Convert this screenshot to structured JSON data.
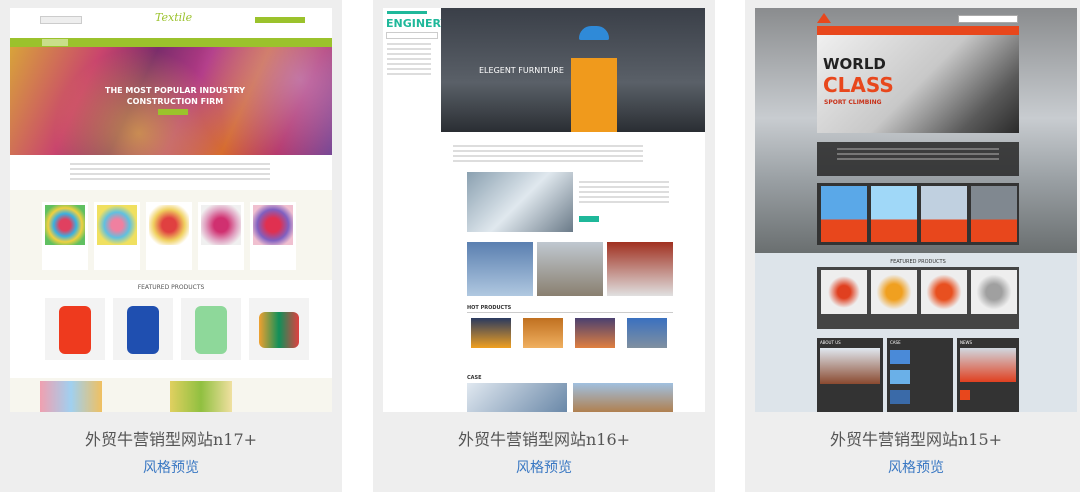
{
  "templates": [
    {
      "caption": "外贸牛营销型网站n17+",
      "preview_label": "风格预览",
      "logo_text": "Textile",
      "hero_title": "THE MOST POPULAR INDUSTRY CONSTRUCTION FIRM",
      "section_title": "FEATURED PRODUCTS",
      "colors": {
        "accent": "#9bc22c",
        "bg": "#f7f6ee"
      }
    },
    {
      "caption": "外贸牛营销型网站n16+",
      "preview_label": "风格预览",
      "logo_text": "ENGINERY",
      "hero_title": "ELEGENT FURNITURE",
      "section_title": "HOT PRODUCTS",
      "case_title": "CASE",
      "colors": {
        "accent": "#1fb89a",
        "bg": "#ffffff"
      }
    },
    {
      "caption": "外贸牛营销型网站n15+",
      "preview_label": "风格预览",
      "hero_title_1": "WORLD",
      "hero_title_2": "CLASS",
      "hero_sub": "SPORT CLIMBING",
      "section_title": "FEATURED PRODUCTS",
      "about_title": "ABOUT US",
      "news_title": "NEWS",
      "case_title": "CASE",
      "colors": {
        "accent": "#e8471c",
        "bg": "#dde4ea"
      }
    }
  ]
}
